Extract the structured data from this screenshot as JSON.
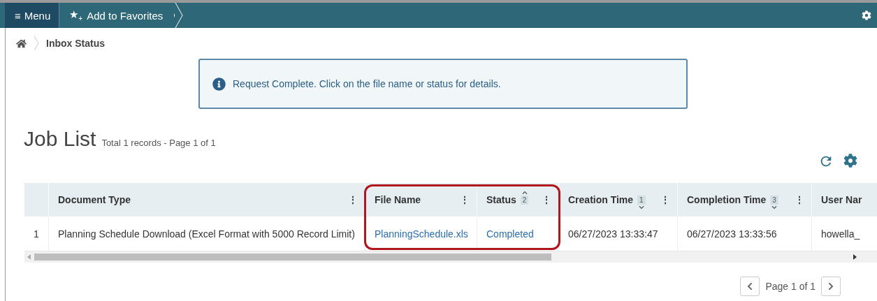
{
  "topbar": {
    "menu": {
      "icon": "≡",
      "label": "Menu"
    },
    "favorites": {
      "icon": "★",
      "icon_sub": "+",
      "label": "Add to Favorites"
    }
  },
  "breadcrumb": [
    "Inbox Status"
  ],
  "alert": {
    "text": "Request Complete. Click on the file name or status for details."
  },
  "job_list": {
    "title": "Job List",
    "summary": "Total 1 records - Page 1 of 1"
  },
  "table": {
    "columns": [
      {
        "highlighted": false
      },
      {
        "label": "Document Type",
        "menu_icon": "⋮",
        "highlighted": false
      },
      {
        "label": "File Name",
        "menu_icon": "⋮",
        "highlighted": true
      },
      {
        "label": "Status",
        "menu_icon": "⋮",
        "sort_order": "2",
        "sort_descending": false,
        "highlighted": true
      },
      {
        "label": "Creation Time",
        "menu_icon": "⋮",
        "sort_order": "1",
        "sort_descending": true,
        "highlighted": false
      },
      {
        "label": "Completion Time",
        "menu_icon": "⋮",
        "sort_order": "3",
        "sort_descending": true,
        "highlighted": false
      },
      {
        "label": "User Nar",
        "highlighted": false
      }
    ],
    "rows": [
      {
        "cells": [
          {
            "text": "1",
            "kind": "plain"
          },
          {
            "text": "Planning Schedule Download (Excel Format with 5000 Record Limit)",
            "kind": "plain"
          },
          {
            "text": "PlanningSchedule.xls",
            "kind": "link"
          },
          {
            "text": "Completed",
            "kind": "link"
          },
          {
            "text": "06/27/2023 13:33:47",
            "kind": "plain"
          },
          {
            "text": "06/27/2023 13:33:56",
            "kind": "plain"
          },
          {
            "text": "howella_",
            "kind": "plain"
          }
        ]
      }
    ]
  },
  "pagination": {
    "label": "Page 1 of 1"
  }
}
